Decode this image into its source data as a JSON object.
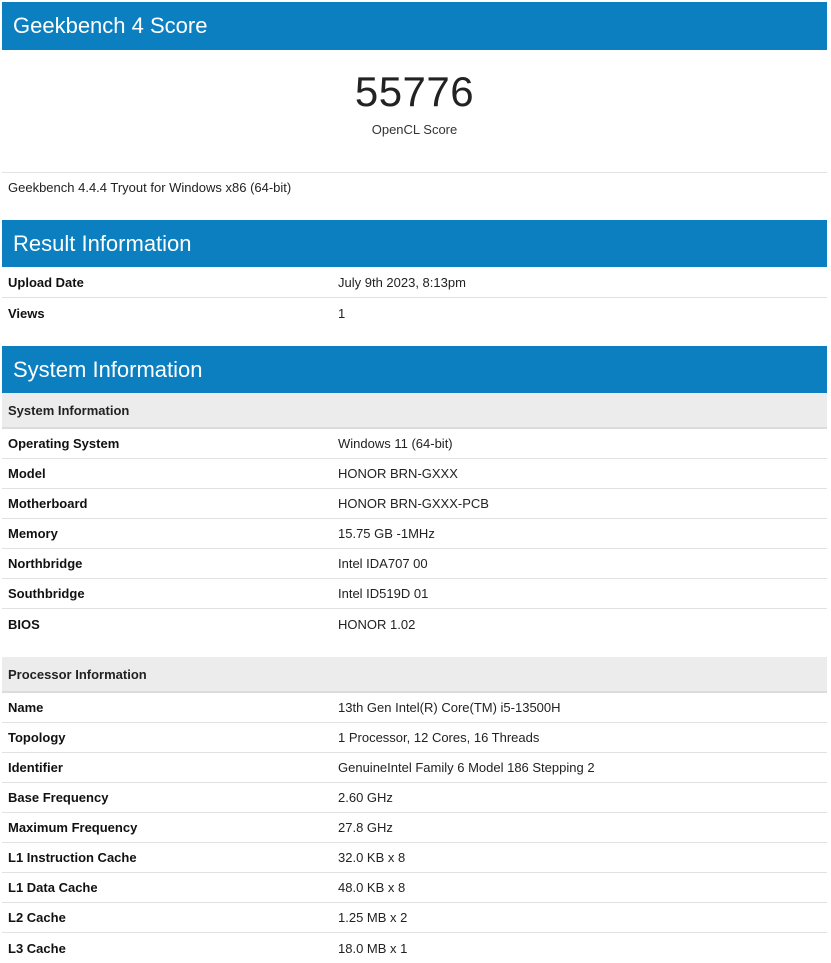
{
  "score_section": {
    "title": "Geekbench 4 Score",
    "score": "55776",
    "score_label": "OpenCL Score",
    "version": "Geekbench 4.4.4 Tryout for Windows x86 (64-bit)"
  },
  "result_section": {
    "title": "Result Information",
    "rows": [
      {
        "label": "Upload Date",
        "value": "July 9th 2023, 8:13pm"
      },
      {
        "label": "Views",
        "value": "1"
      }
    ]
  },
  "system_section": {
    "title": "System Information",
    "system_subtitle": "System Information",
    "system_rows": [
      {
        "label": "Operating System",
        "value": "Windows 11 (64-bit)"
      },
      {
        "label": "Model",
        "value": "HONOR BRN-GXXX"
      },
      {
        "label": "Motherboard",
        "value": "HONOR BRN-GXXX-PCB"
      },
      {
        "label": "Memory",
        "value": "15.75 GB -1MHz"
      },
      {
        "label": "Northbridge",
        "value": "Intel IDA707 00"
      },
      {
        "label": "Southbridge",
        "value": "Intel ID519D 01"
      },
      {
        "label": "BIOS",
        "value": "HONOR 1.02"
      }
    ],
    "processor_subtitle": "Processor Information",
    "processor_rows": [
      {
        "label": "Name",
        "value": "13th Gen Intel(R) Core(TM) i5-13500H"
      },
      {
        "label": "Topology",
        "value": "1 Processor, 12 Cores, 16 Threads"
      },
      {
        "label": "Identifier",
        "value": "GenuineIntel Family 6 Model 186 Stepping 2"
      },
      {
        "label": "Base Frequency",
        "value": "2.60 GHz"
      },
      {
        "label": "Maximum Frequency",
        "value": "27.8 GHz"
      },
      {
        "label": "L1 Instruction Cache",
        "value": "32.0 KB x 8"
      },
      {
        "label": "L1 Data Cache",
        "value": "48.0 KB x 8"
      },
      {
        "label": "L2 Cache",
        "value": "1.25 MB x 2"
      },
      {
        "label": "L3 Cache",
        "value": "18.0 MB x 1"
      }
    ]
  }
}
